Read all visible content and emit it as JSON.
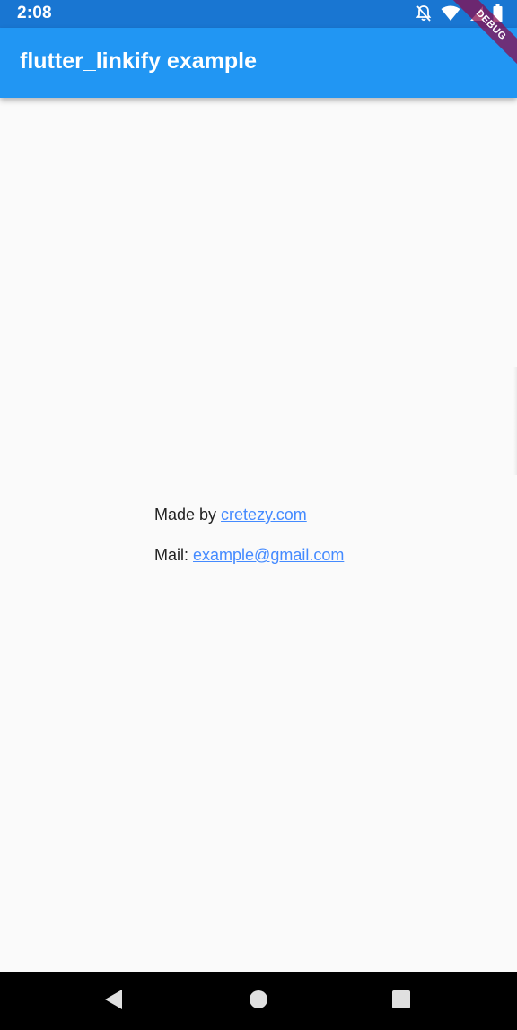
{
  "status_bar": {
    "time": "2:08",
    "icons": [
      "notifications-off-icon",
      "wifi-icon",
      "cell-signal-icon",
      "battery-icon"
    ]
  },
  "app_bar": {
    "title": "flutter_linkify example",
    "color": "#2196f3"
  },
  "debug_banner": {
    "label": "DEBUG"
  },
  "content": {
    "line1": {
      "prefix": "Made by ",
      "link": "cretezy.com"
    },
    "line2": {
      "prefix": "Mail: ",
      "link": "example@gmail.com"
    },
    "link_color": "#448aff"
  },
  "nav_bar": {
    "buttons": [
      "back-icon",
      "home-icon",
      "recents-icon"
    ]
  }
}
